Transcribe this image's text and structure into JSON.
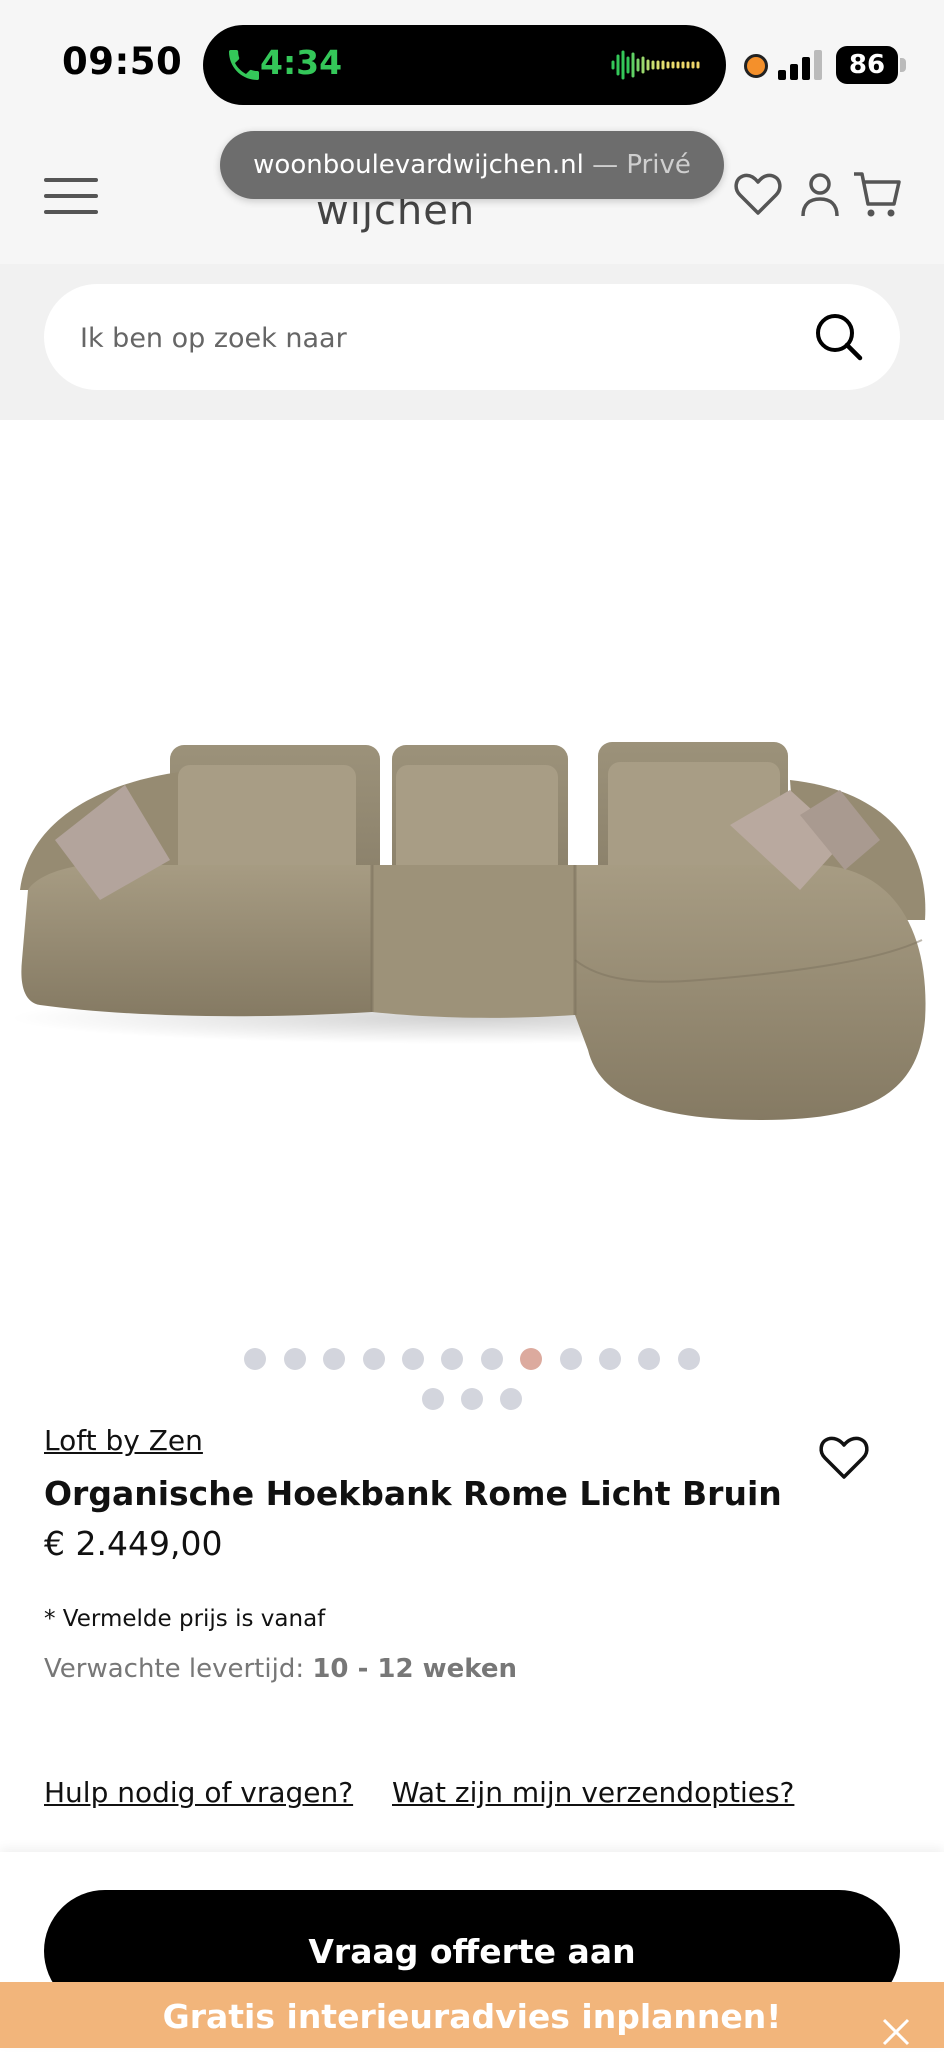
{
  "status_bar": {
    "time": "09:50",
    "call_duration": "4:34",
    "battery": "86",
    "icons": [
      "phone-icon",
      "audio-wave-icon",
      "recording-dot-icon",
      "signal-icon",
      "battery-icon"
    ]
  },
  "browser": {
    "domain": "woonboulevardwijchen.nl",
    "mode": "— Privé"
  },
  "header": {
    "logo_text": "wijchen",
    "icons": [
      "menu-icon",
      "heart-icon",
      "user-icon",
      "cart-icon"
    ]
  },
  "search": {
    "placeholder": "Ik ben op zoek naar"
  },
  "gallery": {
    "dot_count": 15,
    "active_dot": 8
  },
  "product": {
    "brand": "Loft by Zen",
    "title": "Organische Hoekbank Rome Licht Bruin",
    "price": "€ 2.449,00",
    "price_note": "* Vermelde prijs is vanaf",
    "delivery_label": "Verwachte levertijd:",
    "delivery_value": "10 - 12 weken"
  },
  "links": {
    "help": "Hulp nodig of vragen?",
    "shipping": "Wat zijn mijn verzendopties?"
  },
  "cta": {
    "label": "Vraag offerte aan"
  },
  "promo": {
    "label": "Gratis interieuradvies inplannen!"
  },
  "colors": {
    "accent_green": "#34c759",
    "promo_orange": "#f2b57b",
    "active_dot": "#dcaa9e",
    "inactive_dot": "#d3d5dd"
  }
}
